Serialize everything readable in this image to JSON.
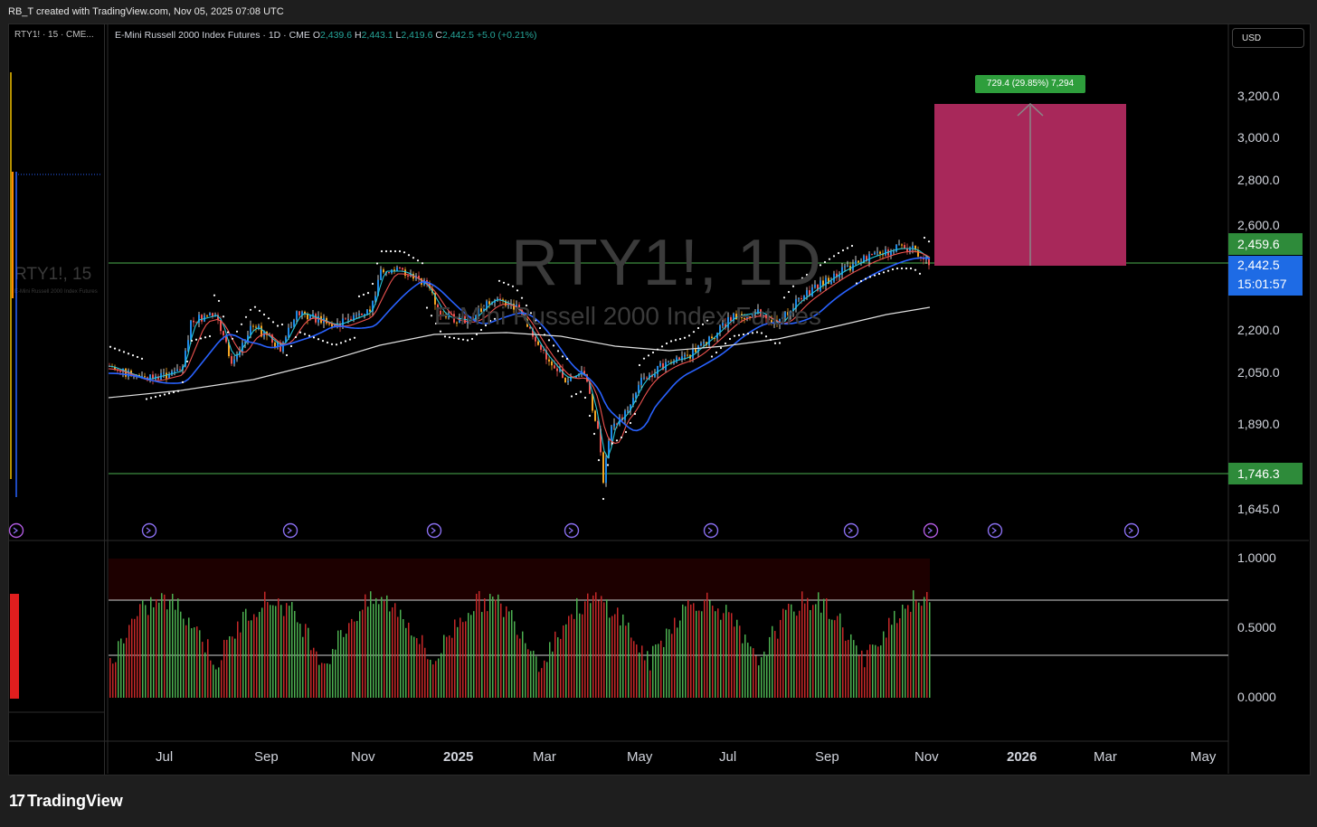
{
  "header": {
    "credit": "RB_T created with TradingView.com, Nov 05, 2025 07:08 UTC"
  },
  "left_pane": {
    "title": "RTY1! · 15 · CME...",
    "watermark": "RTY1!, 15",
    "watermark_sub": "E-Mini Russell 2000 Index Futures"
  },
  "legend": {
    "name": "E-Mini Russell 2000 Index Futures · 1D · CME",
    "o_key": "O",
    "o": "2,439.6",
    "h_key": "H",
    "h": "2,443.1",
    "l_key": "L",
    "l": "2,419.6",
    "c_key": "C",
    "c": "2,442.5",
    "change": "+5.0 (+0.21%)"
  },
  "watermark": {
    "symbol": "RTY1!, 1D",
    "description": "E-Mini Russell 2000 Index Futures"
  },
  "currency_button": "USD",
  "price_axis": [
    "3,200.0",
    "3,000.0",
    "2,800.0",
    "2,600.0",
    "2,200.0",
    "2,050.0",
    "1,890.0",
    "1,645.0"
  ],
  "price_tags": {
    "level_high": "2,459.6",
    "last_price": "2,442.5",
    "countdown": "15:01:57",
    "level_low": "1,746.3"
  },
  "measure_label": "729.4 (29.85%) 7,294",
  "indicator_axis": [
    "1.0000",
    "0.5000",
    "0.0000"
  ],
  "time_axis": [
    {
      "label": "Jul",
      "bold": false
    },
    {
      "label": "Sep",
      "bold": false
    },
    {
      "label": "Nov",
      "bold": false
    },
    {
      "label": "2025",
      "bold": true
    },
    {
      "label": "Mar",
      "bold": false
    },
    {
      "label": "May",
      "bold": false
    },
    {
      "label": "Jul",
      "bold": false
    },
    {
      "label": "Sep",
      "bold": false
    },
    {
      "label": "Nov",
      "bold": false
    },
    {
      "label": "2026",
      "bold": true
    },
    {
      "label": "Mar",
      "bold": false
    },
    {
      "label": "May",
      "bold": false
    }
  ],
  "brand": "TradingView",
  "colors": {
    "up": "#26a69a",
    "down": "#ef5350",
    "target_box": "#b3295a",
    "level_line": "#4caf50",
    "ema_blue": "#2962ff"
  }
}
